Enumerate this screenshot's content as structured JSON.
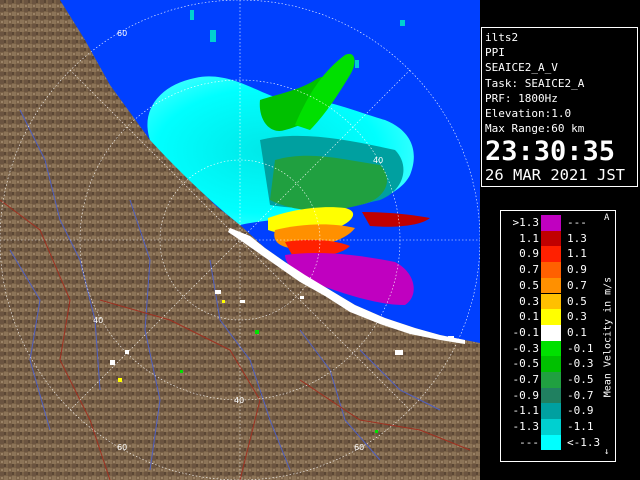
{
  "info": {
    "site": "ilts2",
    "product": "PPI",
    "scan": "SEAICE2_A_V",
    "task_label": "Task: SEAICE2_A",
    "prf_label": "PRF: 1800Hz",
    "elevation_label": "Elevation:1.0",
    "max_range_label": "Max Range:60 km",
    "time": "23:30:35",
    "date": "26 MAR 2021 JST"
  },
  "range_labels": [
    "60",
    "40",
    "40",
    "40",
    "40",
    "60",
    "60"
  ],
  "legend": {
    "title": "Mean Velocity in m/s",
    "cap_top": "A",
    "cap_bottom": "↓",
    "rows": [
      {
        "low": ">1.3",
        "high": "---",
        "color": "#c000c0"
      },
      {
        "low": "1.1",
        "high": "1.3",
        "color": "#c00000"
      },
      {
        "low": "0.9",
        "high": "1.1",
        "color": "#ff2000"
      },
      {
        "low": "0.7",
        "high": "0.9",
        "color": "#ff6000"
      },
      {
        "low": "0.5",
        "high": "0.7",
        "color": "#ff9000"
      },
      {
        "low": "0.3",
        "high": "0.5",
        "color": "#ffc000"
      },
      {
        "low": "0.1",
        "high": "0.3",
        "color": "#ffff00"
      },
      {
        "low": "-0.1",
        "high": "0.1",
        "color": "#ffffff"
      },
      {
        "low": "-0.3",
        "high": "-0.1",
        "color": "#00e000"
      },
      {
        "low": "-0.5",
        "high": "-0.3",
        "color": "#00c000"
      },
      {
        "low": "-0.7",
        "high": "-0.5",
        "color": "#20a040"
      },
      {
        "low": "-0.9",
        "high": "-0.7",
        "color": "#208060"
      },
      {
        "low": "-1.1",
        "high": "-0.9",
        "color": "#00a0a0"
      },
      {
        "low": "-1.3",
        "high": "-1.1",
        "color": "#00d0d0"
      },
      {
        "low": "---",
        "high": "<-1.3",
        "color": "#00ffff"
      }
    ]
  },
  "colors": {
    "sea": "#0040ff",
    "land": "#7a6248",
    "background": "#000000",
    "rings": "#ffffff",
    "rivers": "#5060c0",
    "borders": "#a03020"
  }
}
